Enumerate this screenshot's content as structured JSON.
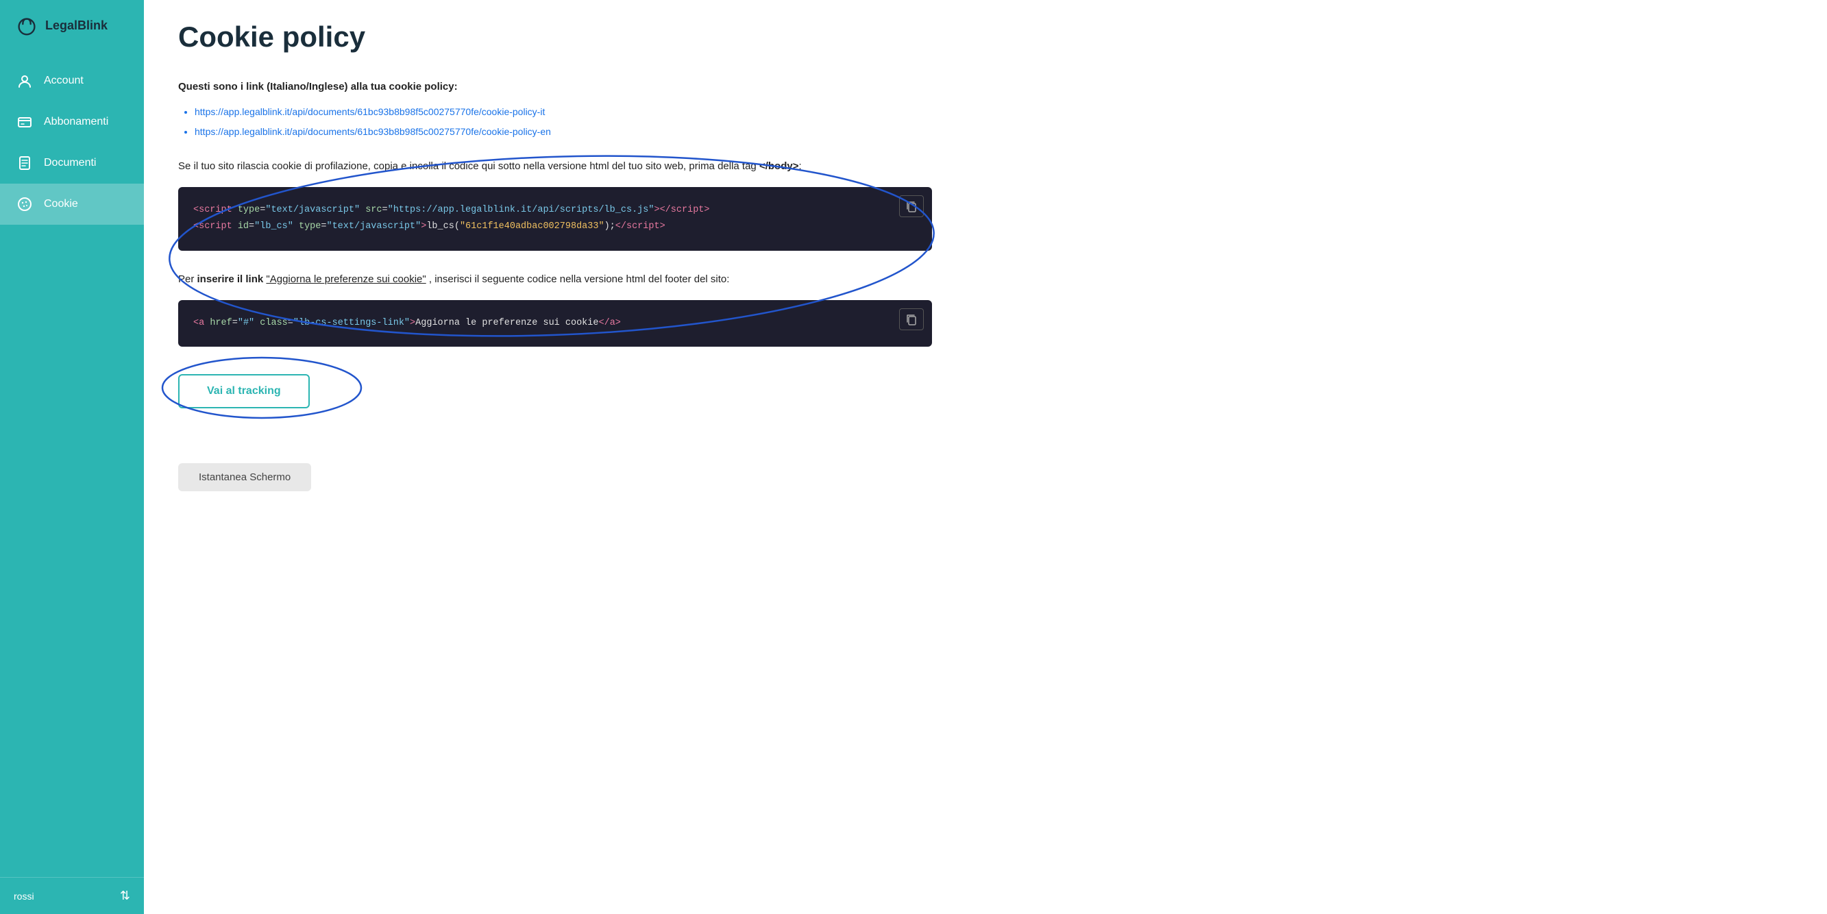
{
  "app": {
    "name": "LegalBlink"
  },
  "sidebar": {
    "items": [
      {
        "id": "account",
        "label": "Account",
        "icon": "account-icon",
        "active": false
      },
      {
        "id": "abbonamenti",
        "label": "Abbonamenti",
        "icon": "abbonamenti-icon",
        "active": false
      },
      {
        "id": "documenti",
        "label": "Documenti",
        "icon": "documenti-icon",
        "active": false
      },
      {
        "id": "cookie",
        "label": "Cookie",
        "icon": "cookie-icon",
        "active": true
      }
    ],
    "footer": {
      "username": "rossi",
      "chevron": "⇅"
    }
  },
  "main": {
    "page_title": "Cookie policy",
    "links_label": "Questi sono i link (Italiano/Inglese) alla tua cookie policy:",
    "links": [
      "https://app.legalblink.it/api/documents/61bc93b8b98f5c00275770fe/cookie-policy-it",
      "https://app.legalblink.it/api/documents/61bc93b8b98f5c00275770fe/cookie-policy-en"
    ],
    "profilazione_text_before": "Se il tuo sito rilascia cookie di profilazione, copia e incolla il codice qui sotto nella versione html del tuo sito web, prima della tag ",
    "profilazione_tag": "</body>",
    "profilazione_text_after": ":",
    "code_block_1": {
      "line1_pre": "<script type=\"text/javascript\" src=\"https://app.legalblink.it/api/scripts/lb_cs.js\"></",
      "line1_close": "script>",
      "line2_pre": "<script id=\"lb_cs\" type=\"text/javascript\">lb_cs(\"",
      "line2_arg": "61c1f1e40adbac002798da33",
      "line2_post": "\");</",
      "line2_close": "script>"
    },
    "insert_text_pre": "Per ",
    "insert_strong": "inserire il link",
    "insert_link_text": "\"Aggiorna le preferenze sui cookie\"",
    "insert_text_post": ", inserisci il seguente codice nella versione html del footer del sito:",
    "code_block_2": {
      "content": "<a href=\"#\" class=\"lb-cs-settings-link\">Aggiorna le preferenze sui cookie</a>"
    },
    "vai_button": "Vai al tracking",
    "bottom_button": "Istantanea Schermo"
  }
}
